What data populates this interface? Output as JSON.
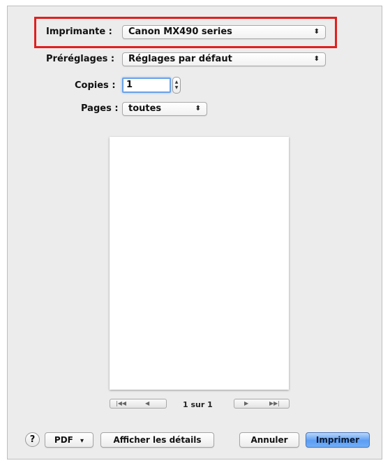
{
  "print_dialog": {
    "printer": {
      "label": "Imprimante :",
      "value": "Canon MX490 series"
    },
    "presets": {
      "label": "Préréglages :",
      "value": "Réglages par défaut"
    },
    "copies": {
      "label": "Copies :",
      "value": "1"
    },
    "pages": {
      "label": "Pages :",
      "value": "toutes"
    },
    "popup_arrows": "⬍",
    "stepper": {
      "up": "▲",
      "down": "▼"
    },
    "preview_nav": {
      "first": "|◀◀",
      "prev": "◀",
      "next": "▶",
      "last": "▶▶|",
      "page_indicator": "1 sur 1"
    },
    "footer": {
      "help": "?",
      "pdf": "PDF",
      "pdf_arrow": "▾",
      "details": "Afficher les détails",
      "cancel": "Annuler",
      "print": "Imprimer"
    },
    "highlight_color": "#e02020",
    "accent_color": "#5c9df3"
  }
}
